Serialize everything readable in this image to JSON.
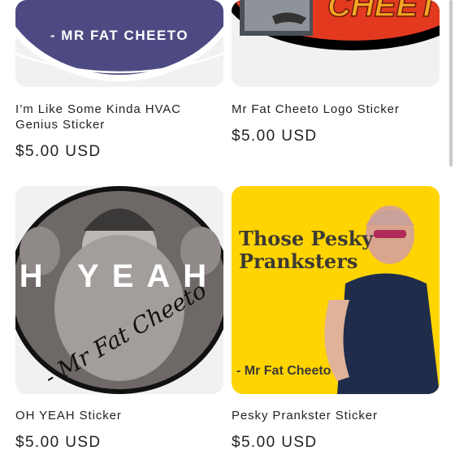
{
  "products": [
    {
      "image_text": "- MR FAT CHEETO",
      "title": "I’m Like Some Kinda HVAC Genius Sticker",
      "price": "$5.00 USD"
    },
    {
      "image_text": "CHEET",
      "title": "Mr Fat Cheeto Logo Sticker",
      "price": "$5.00 USD"
    },
    {
      "image_text": "H YEAH",
      "image_signature": "- Mr Fat Cheeto",
      "title": "OH YEAH Sticker",
      "price": "$5.00 USD"
    },
    {
      "image_text": "Those Pesky Pranksters",
      "image_caption": "- Mr Fat Cheeto",
      "title": "Pesky Prankster Sticker",
      "price": "$5.00 USD"
    }
  ]
}
